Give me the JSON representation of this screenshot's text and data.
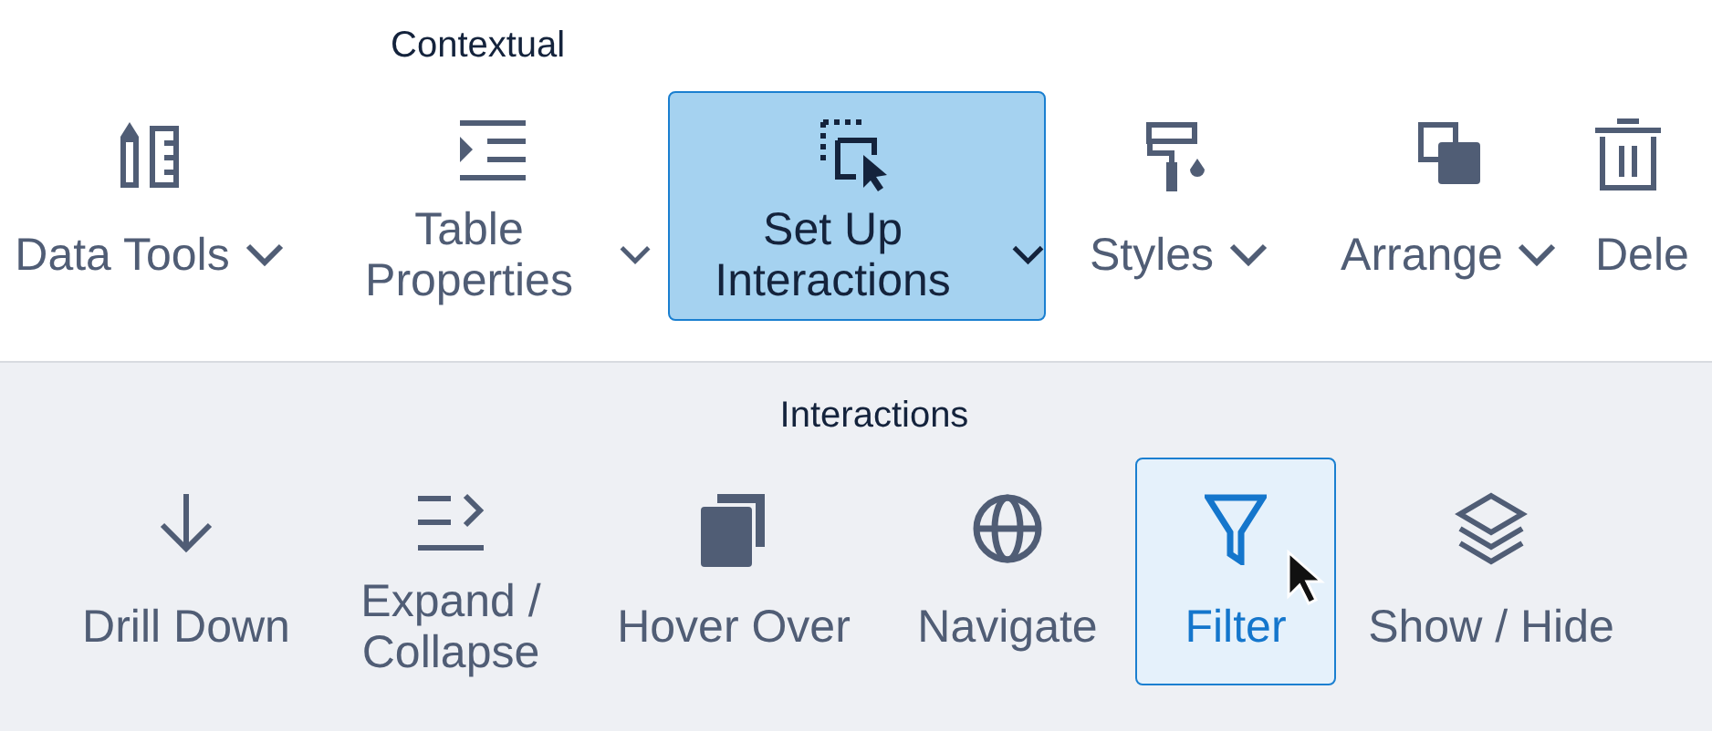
{
  "contextual": {
    "title": "Contextual",
    "items": [
      {
        "label": "Data Tools",
        "has_menu": true,
        "selected": false
      },
      {
        "label": "Table Properties",
        "has_menu": true,
        "selected": false
      },
      {
        "label": "Set Up Interactions",
        "has_menu": true,
        "selected": true
      },
      {
        "label": "Styles",
        "has_menu": true,
        "selected": false
      },
      {
        "label": "Arrange",
        "has_menu": true,
        "selected": false
      },
      {
        "label": "Dele",
        "selected": false
      }
    ]
  },
  "interactions": {
    "title": "Interactions",
    "items": [
      {
        "label": "Drill Down",
        "selected": false
      },
      {
        "label": "Expand / Collapse",
        "selected": false
      },
      {
        "label": "Hover Over",
        "selected": false
      },
      {
        "label": "Navigate",
        "selected": false
      },
      {
        "label": "Filter",
        "selected": true
      },
      {
        "label": "Show / Hide",
        "selected": false
      }
    ]
  }
}
